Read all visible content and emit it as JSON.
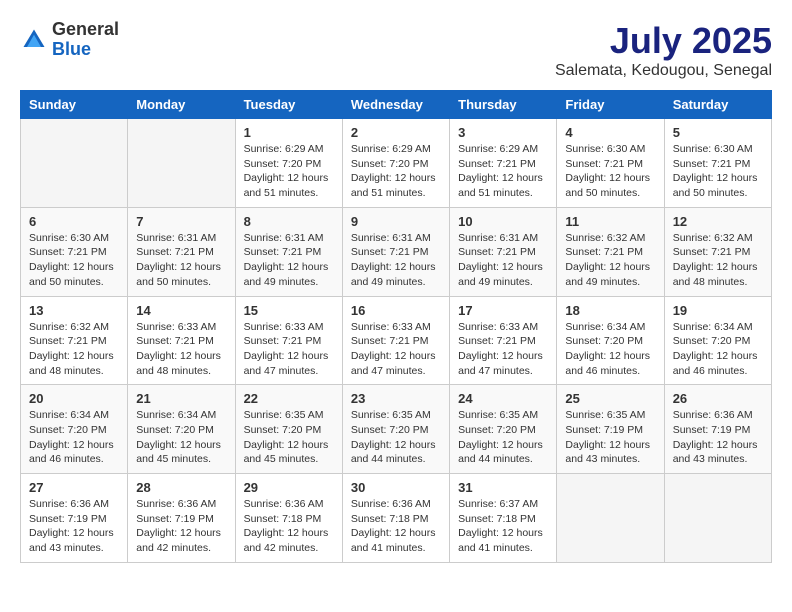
{
  "header": {
    "logo": {
      "general": "General",
      "blue": "Blue"
    },
    "month": "July 2025",
    "location": "Salemata, Kedougou, Senegal"
  },
  "weekdays": [
    "Sunday",
    "Monday",
    "Tuesday",
    "Wednesday",
    "Thursday",
    "Friday",
    "Saturday"
  ],
  "weeks": [
    [
      {
        "day": "",
        "info": ""
      },
      {
        "day": "",
        "info": ""
      },
      {
        "day": "1",
        "info": "Sunrise: 6:29 AM\nSunset: 7:20 PM\nDaylight: 12 hours and 51 minutes."
      },
      {
        "day": "2",
        "info": "Sunrise: 6:29 AM\nSunset: 7:20 PM\nDaylight: 12 hours and 51 minutes."
      },
      {
        "day": "3",
        "info": "Sunrise: 6:29 AM\nSunset: 7:21 PM\nDaylight: 12 hours and 51 minutes."
      },
      {
        "day": "4",
        "info": "Sunrise: 6:30 AM\nSunset: 7:21 PM\nDaylight: 12 hours and 50 minutes."
      },
      {
        "day": "5",
        "info": "Sunrise: 6:30 AM\nSunset: 7:21 PM\nDaylight: 12 hours and 50 minutes."
      }
    ],
    [
      {
        "day": "6",
        "info": "Sunrise: 6:30 AM\nSunset: 7:21 PM\nDaylight: 12 hours and 50 minutes."
      },
      {
        "day": "7",
        "info": "Sunrise: 6:31 AM\nSunset: 7:21 PM\nDaylight: 12 hours and 50 minutes."
      },
      {
        "day": "8",
        "info": "Sunrise: 6:31 AM\nSunset: 7:21 PM\nDaylight: 12 hours and 49 minutes."
      },
      {
        "day": "9",
        "info": "Sunrise: 6:31 AM\nSunset: 7:21 PM\nDaylight: 12 hours and 49 minutes."
      },
      {
        "day": "10",
        "info": "Sunrise: 6:31 AM\nSunset: 7:21 PM\nDaylight: 12 hours and 49 minutes."
      },
      {
        "day": "11",
        "info": "Sunrise: 6:32 AM\nSunset: 7:21 PM\nDaylight: 12 hours and 49 minutes."
      },
      {
        "day": "12",
        "info": "Sunrise: 6:32 AM\nSunset: 7:21 PM\nDaylight: 12 hours and 48 minutes."
      }
    ],
    [
      {
        "day": "13",
        "info": "Sunrise: 6:32 AM\nSunset: 7:21 PM\nDaylight: 12 hours and 48 minutes."
      },
      {
        "day": "14",
        "info": "Sunrise: 6:33 AM\nSunset: 7:21 PM\nDaylight: 12 hours and 48 minutes."
      },
      {
        "day": "15",
        "info": "Sunrise: 6:33 AM\nSunset: 7:21 PM\nDaylight: 12 hours and 47 minutes."
      },
      {
        "day": "16",
        "info": "Sunrise: 6:33 AM\nSunset: 7:21 PM\nDaylight: 12 hours and 47 minutes."
      },
      {
        "day": "17",
        "info": "Sunrise: 6:33 AM\nSunset: 7:21 PM\nDaylight: 12 hours and 47 minutes."
      },
      {
        "day": "18",
        "info": "Sunrise: 6:34 AM\nSunset: 7:20 PM\nDaylight: 12 hours and 46 minutes."
      },
      {
        "day": "19",
        "info": "Sunrise: 6:34 AM\nSunset: 7:20 PM\nDaylight: 12 hours and 46 minutes."
      }
    ],
    [
      {
        "day": "20",
        "info": "Sunrise: 6:34 AM\nSunset: 7:20 PM\nDaylight: 12 hours and 46 minutes."
      },
      {
        "day": "21",
        "info": "Sunrise: 6:34 AM\nSunset: 7:20 PM\nDaylight: 12 hours and 45 minutes."
      },
      {
        "day": "22",
        "info": "Sunrise: 6:35 AM\nSunset: 7:20 PM\nDaylight: 12 hours and 45 minutes."
      },
      {
        "day": "23",
        "info": "Sunrise: 6:35 AM\nSunset: 7:20 PM\nDaylight: 12 hours and 44 minutes."
      },
      {
        "day": "24",
        "info": "Sunrise: 6:35 AM\nSunset: 7:20 PM\nDaylight: 12 hours and 44 minutes."
      },
      {
        "day": "25",
        "info": "Sunrise: 6:35 AM\nSunset: 7:19 PM\nDaylight: 12 hours and 43 minutes."
      },
      {
        "day": "26",
        "info": "Sunrise: 6:36 AM\nSunset: 7:19 PM\nDaylight: 12 hours and 43 minutes."
      }
    ],
    [
      {
        "day": "27",
        "info": "Sunrise: 6:36 AM\nSunset: 7:19 PM\nDaylight: 12 hours and 43 minutes."
      },
      {
        "day": "28",
        "info": "Sunrise: 6:36 AM\nSunset: 7:19 PM\nDaylight: 12 hours and 42 minutes."
      },
      {
        "day": "29",
        "info": "Sunrise: 6:36 AM\nSunset: 7:18 PM\nDaylight: 12 hours and 42 minutes."
      },
      {
        "day": "30",
        "info": "Sunrise: 6:36 AM\nSunset: 7:18 PM\nDaylight: 12 hours and 41 minutes."
      },
      {
        "day": "31",
        "info": "Sunrise: 6:37 AM\nSunset: 7:18 PM\nDaylight: 12 hours and 41 minutes."
      },
      {
        "day": "",
        "info": ""
      },
      {
        "day": "",
        "info": ""
      }
    ]
  ]
}
